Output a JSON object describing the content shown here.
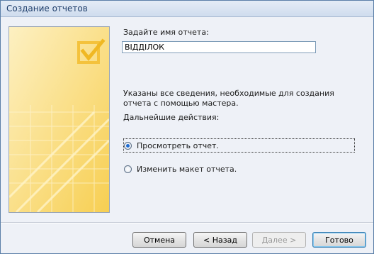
{
  "window": {
    "title": "Создание отчетов"
  },
  "form": {
    "name_label": "Задайте имя отчета:",
    "name_value": "ВІДДІЛОК",
    "info_text": "Указаны все сведения, необходимые для создания отчета с помощью мастера.",
    "next_actions_label": "Дальнейшие действия:",
    "options": [
      {
        "label": "Просмотреть отчет.",
        "checked": true
      },
      {
        "label": "Изменить макет отчета.",
        "checked": false
      }
    ]
  },
  "buttons": {
    "cancel": "Отмена",
    "back": "< Назад",
    "next": "Далее >",
    "finish": "Готово"
  },
  "colors": {
    "accent": "#3c7fb1",
    "art_background": "#fbe6a0",
    "art_highlight": "#f6c53a"
  },
  "icons": {
    "art": "wizard-checkmark-illustration"
  }
}
